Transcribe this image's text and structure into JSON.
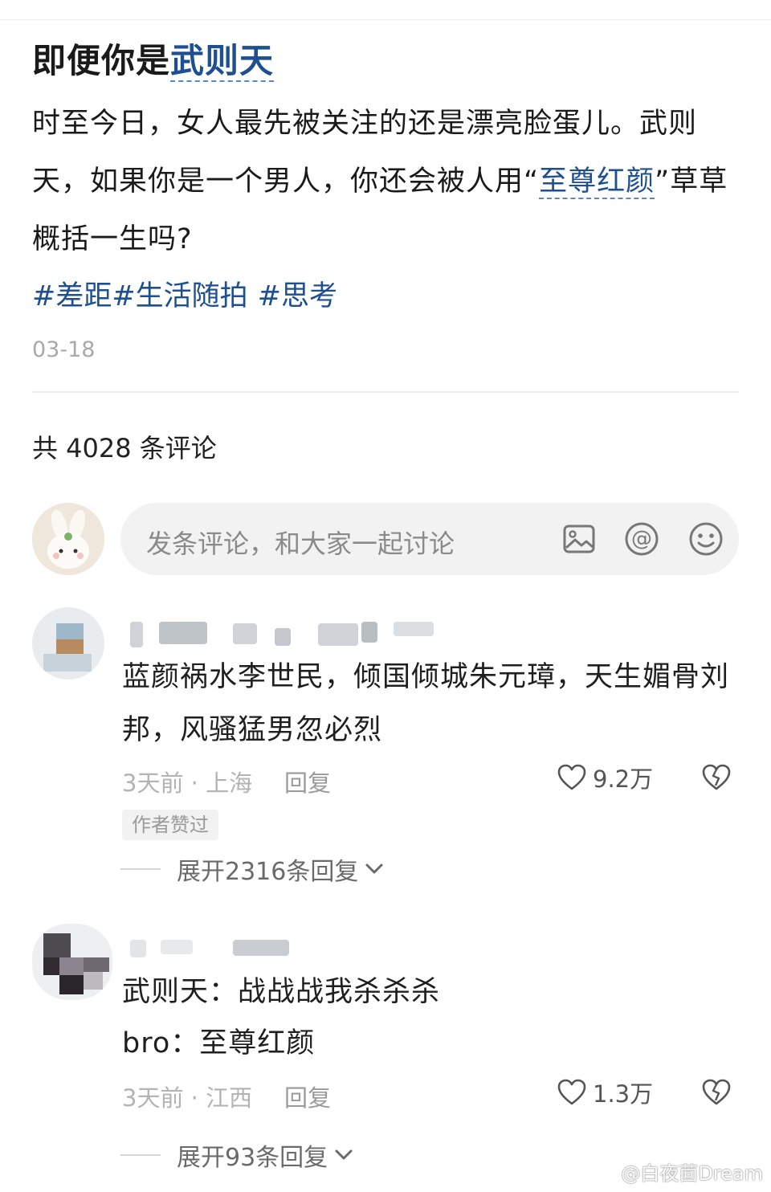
{
  "post": {
    "title_prefix": "即便你是",
    "title_keyword": "武则天",
    "body_part1": "时至今日，女人最先被关注的还是漂亮脸蛋儿。武则天，如果你是一个男人，你还会被人用“",
    "body_keyword": "至尊红颜",
    "body_part2": "”草草概括一生吗?",
    "tags": [
      "#差距",
      "#生活随拍",
      "#思考"
    ],
    "date": "03-18"
  },
  "comments_header": {
    "count_text": "共 4028 条评论"
  },
  "comment_input": {
    "placeholder": "发条评论，和大家一起讨论",
    "icons": [
      "image-icon",
      "at-icon",
      "emoji-icon"
    ]
  },
  "comments": [
    {
      "text": "蓝颜祸水李世民，倾国倾城朱元璋，天生媚骨刘邦，风骚猛男忽必烈",
      "time_location": "3天前 · 上海",
      "reply_label": "回复",
      "likes": "9.2万",
      "badge": "作者赞过",
      "expand_label": "展开2316条回复"
    },
    {
      "line1": "武则天：战战战我杀杀杀",
      "line2": "bro：至尊红颜",
      "time_location": "3天前 · 江西",
      "reply_label": "回复",
      "likes": "1.3万",
      "expand_label": "展开93条回复"
    }
  ],
  "watermark": "@白夜茴Dream",
  "colors": {
    "link": "#1d4f91",
    "muted": "#b3b3b3",
    "input_bg": "#f2f2f2"
  }
}
